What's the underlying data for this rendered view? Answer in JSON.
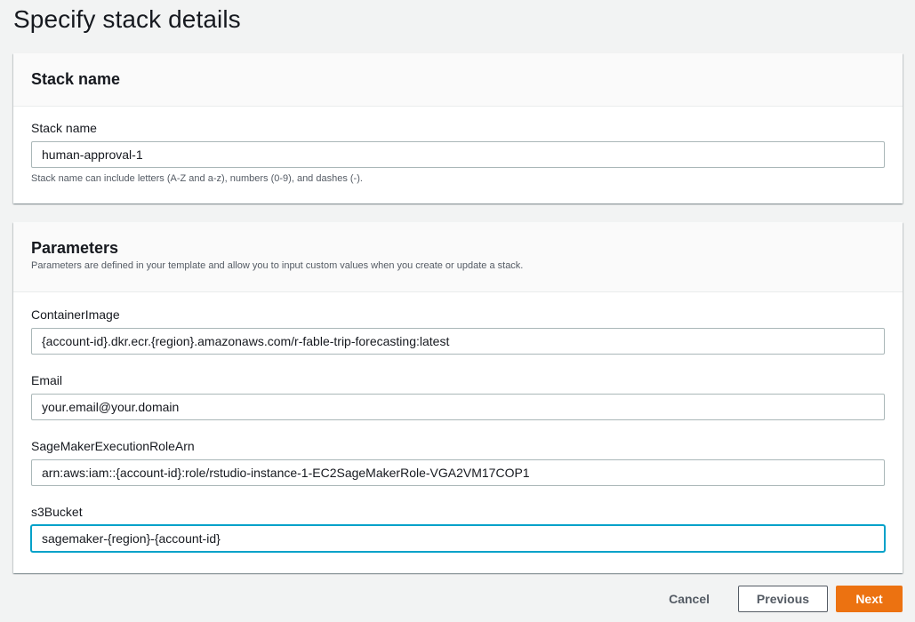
{
  "page": {
    "title": "Specify stack details"
  },
  "stack_name_section": {
    "heading": "Stack name",
    "field_label": "Stack name",
    "value": "human-approval-1",
    "hint": "Stack name can include letters (A-Z and a-z), numbers (0-9), and dashes (-)."
  },
  "parameters_section": {
    "heading": "Parameters",
    "description": "Parameters are defined in your template and allow you to input custom values when you create or update a stack.",
    "fields": [
      {
        "label": "ContainerImage",
        "value": "{account-id}.dkr.ecr.{region}.amazonaws.com/r-fable-trip-forecasting:latest"
      },
      {
        "label": "Email",
        "value": "your.email@your.domain"
      },
      {
        "label": "SageMakerExecutionRoleArn",
        "value": "arn:aws:iam::{account-id}:role/rstudio-instance-1-EC2SageMakerRole-VGA2VM17COP1"
      },
      {
        "label": "s3Bucket",
        "value": "sagemaker-{region}-{account-id}"
      }
    ]
  },
  "footer": {
    "cancel_label": "Cancel",
    "previous_label": "Previous",
    "next_label": "Next"
  },
  "colors": {
    "page_background": "#f2f3f3",
    "primary_button": "#ec7211",
    "focus_ring": "#00a1c9",
    "text": "#16191f",
    "secondary_text": "#545b64"
  }
}
